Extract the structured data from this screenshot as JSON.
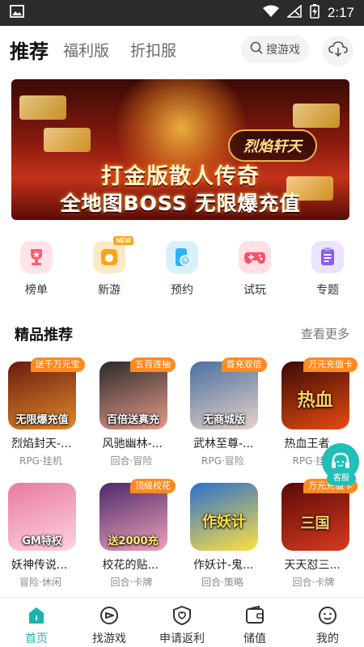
{
  "status_bar": {
    "time": "2:17"
  },
  "header": {
    "tabs": [
      {
        "label": "推荐",
        "active": true
      },
      {
        "label": "福利版",
        "active": false
      },
      {
        "label": "折扣服",
        "active": false
      }
    ],
    "search_label": "搜游戏"
  },
  "banner": {
    "logo_text": "烈焰轩天",
    "line1": "打金版散人传奇",
    "line2": "全地图BOSS 无限爆充值"
  },
  "categories": [
    {
      "label": "榜单",
      "icon": "trophy-icon",
      "color": "#ff5b6e"
    },
    {
      "label": "新游",
      "icon": "new-game-icon",
      "color": "#ffa31a",
      "tag": "NEW"
    },
    {
      "label": "预约",
      "icon": "reserve-icon",
      "color": "#2fb3f5"
    },
    {
      "label": "试玩",
      "icon": "gamepad-icon",
      "color": "#ff4f66"
    },
    {
      "label": "专题",
      "icon": "topic-icon",
      "color": "#8a5cf0"
    }
  ],
  "section": {
    "title": "精品推荐",
    "more": "查看更多"
  },
  "games": [
    {
      "name": "烈焰封天-...",
      "genre": "RPG·挂机",
      "badge": "送千万元宝",
      "cover_text": "无限爆充值",
      "c1": "#6a1a10",
      "c2": "#e08a2a"
    },
    {
      "name": "风驰幽林-...",
      "genre": "回合·冒险",
      "badge": "五百连抽",
      "cover_text": "百倍送真充",
      "c1": "#2a2a2a",
      "c2": "#e89a8a"
    },
    {
      "name": "武林至尊-...",
      "genre": "RPG·冒险",
      "badge": "首充双倍",
      "cover_text": "无商城版",
      "c1": "#4a6fa0",
      "c2": "#e8d2c8"
    },
    {
      "name": "热血王者",
      "genre": "RPG·挂",
      "badge": "万元充值卡",
      "cover_text": "热血",
      "c1": "#3a0a04",
      "c2": "#e84a12"
    },
    {
      "name": "妖神传说...",
      "genre": "冒险·休闲",
      "badge": "",
      "cover_text": "GM特权",
      "c1": "#e87aa0",
      "c2": "#ffd2e0"
    },
    {
      "name": "校花的贴...",
      "genre": "回合·卡牌",
      "badge": "顶级校花",
      "cover_text": "送2000充",
      "c1": "#4a2a6a",
      "c2": "#f0a0b8"
    },
    {
      "name": "作妖计-鬼...",
      "genre": "回合·策略",
      "badge": "",
      "cover_text": "作妖计",
      "c1": "#2a70d0",
      "c2": "#ffe040"
    },
    {
      "name": "天天怼三...",
      "genre": "回合·卡牌",
      "badge": "万元充值卡",
      "cover_text": "三国",
      "c1": "#5a0a08",
      "c2": "#d83a20"
    }
  ],
  "customer_service": {
    "label": "客服"
  },
  "bottom_nav": [
    {
      "label": "首页",
      "icon": "home-icon",
      "active": true
    },
    {
      "label": "找游戏",
      "icon": "find-game-icon",
      "active": false
    },
    {
      "label": "申请返利",
      "icon": "rebate-icon",
      "active": false
    },
    {
      "label": "储值",
      "icon": "wallet-icon",
      "active": false
    },
    {
      "label": "我的",
      "icon": "profile-icon",
      "active": false
    }
  ],
  "colors": {
    "accent": "#17b5ad",
    "badge": "#ff8a1f",
    "status_bar": "#2b2b2b"
  }
}
